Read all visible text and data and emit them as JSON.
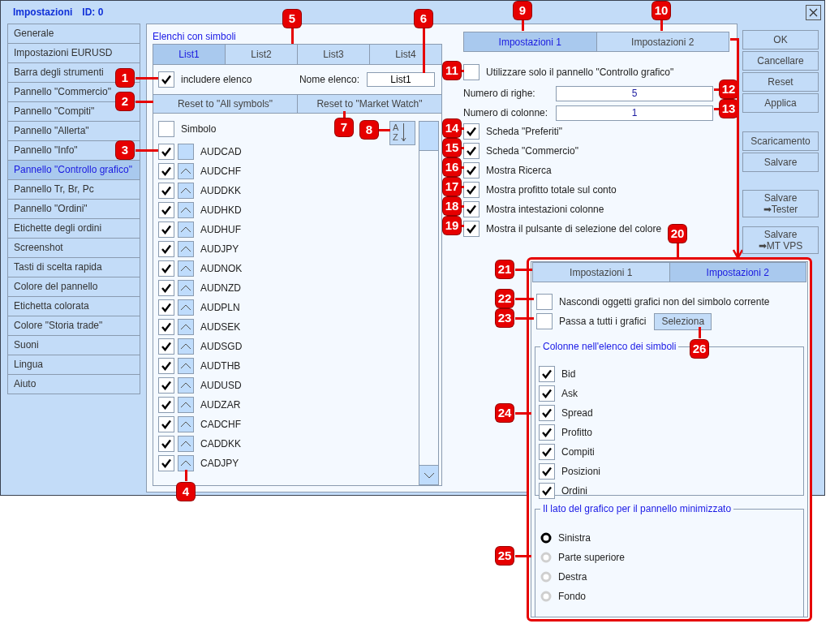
{
  "window": {
    "title": "Impostazioni",
    "id": "ID: 0"
  },
  "sidebar": {
    "items": [
      {
        "label": "Generale",
        "selected": false
      },
      {
        "label": "Impostazioni EURUSD",
        "selected": false
      },
      {
        "label": "Barra degli strumenti",
        "selected": false
      },
      {
        "label": "Pannello \"Commercio\"",
        "selected": false
      },
      {
        "label": "Pannello \"Compiti\"",
        "selected": false
      },
      {
        "label": "Pannello \"Allerta\"",
        "selected": false
      },
      {
        "label": "Pannello \"Info\"",
        "selected": false
      },
      {
        "label": "Pannello \"Controllo grafico\"",
        "selected": true
      },
      {
        "label": "Pannello Tr, Br, Pc",
        "selected": false
      },
      {
        "label": "Pannello \"Ordini\"",
        "selected": false
      },
      {
        "label": "Etichette degli ordini",
        "selected": false
      },
      {
        "label": "Screenshot",
        "selected": false
      },
      {
        "label": "Tasti di scelta rapida",
        "selected": false
      },
      {
        "label": "Colore del pannello",
        "selected": false
      },
      {
        "label": "Etichetta colorata",
        "selected": false
      },
      {
        "label": "Colore \"Storia trade\"",
        "selected": false
      },
      {
        "label": "Suoni",
        "selected": false
      },
      {
        "label": "Lingua",
        "selected": false
      },
      {
        "label": "Aiuto",
        "selected": false
      }
    ]
  },
  "symbol_lists": {
    "title": "Elenchi con simboli",
    "tabs": [
      {
        "label": "List1",
        "selected": true
      },
      {
        "label": "List2",
        "selected": false
      },
      {
        "label": "List3",
        "selected": false
      },
      {
        "label": "List4",
        "selected": false
      }
    ],
    "include": {
      "label": "includere elenco",
      "checked": true
    },
    "name_label": "Nome elenco:",
    "name_value": "List1",
    "reset_buttons": [
      "Reset to \"All symbols\"",
      "Reset to \"Market Watch\""
    ],
    "header": {
      "label": "Simbolo",
      "checked": false
    },
    "sort_button": {
      "top": "A",
      "bottom": "Z"
    },
    "symbols": [
      {
        "name": "AUDCAD",
        "checked": true,
        "arrow": false
      },
      {
        "name": "AUDCHF",
        "checked": true,
        "arrow": true
      },
      {
        "name": "AUDDKK",
        "checked": true,
        "arrow": true
      },
      {
        "name": "AUDHKD",
        "checked": true,
        "arrow": true
      },
      {
        "name": "AUDHUF",
        "checked": true,
        "arrow": true
      },
      {
        "name": "AUDJPY",
        "checked": true,
        "arrow": true
      },
      {
        "name": "AUDNOK",
        "checked": true,
        "arrow": true
      },
      {
        "name": "AUDNZD",
        "checked": true,
        "arrow": true
      },
      {
        "name": "AUDPLN",
        "checked": true,
        "arrow": true
      },
      {
        "name": "AUDSEK",
        "checked": true,
        "arrow": true
      },
      {
        "name": "AUDSGD",
        "checked": true,
        "arrow": true
      },
      {
        "name": "AUDTHB",
        "checked": true,
        "arrow": true
      },
      {
        "name": "AUDUSD",
        "checked": true,
        "arrow": true
      },
      {
        "name": "AUDZAR",
        "checked": true,
        "arrow": true
      },
      {
        "name": "CADCHF",
        "checked": true,
        "arrow": true
      },
      {
        "name": "CADDKK",
        "checked": true,
        "arrow": true
      },
      {
        "name": "CADJPY",
        "checked": true,
        "arrow": true
      }
    ]
  },
  "settings": {
    "tabs": [
      {
        "label": "Impostazioni 1",
        "selected": true
      },
      {
        "label": "Impostazioni 2",
        "selected": false
      }
    ],
    "use_only": {
      "label": "Utilizzare solo il pannello \"Controllo grafico\"",
      "checked": false
    },
    "fields": [
      {
        "label": "Numero di righe:",
        "value": "5"
      },
      {
        "label": "Numero di colonne:",
        "value": "1"
      }
    ],
    "options": [
      {
        "label": "Scheda \"Preferiti\"",
        "checked": true
      },
      {
        "label": "Scheda \"Commercio\"",
        "checked": true
      },
      {
        "label": "Mostra Ricerca",
        "checked": true
      },
      {
        "label": "Mostra profitto totale sul conto",
        "checked": true
      },
      {
        "label": "Mostra intestazioni colonne",
        "checked": true
      },
      {
        "label": "Mostra il pulsante di selezione del colore",
        "checked": true
      }
    ]
  },
  "button_groups": [
    [
      {
        "lines": [
          "OK"
        ]
      },
      {
        "lines": [
          "Cancellare"
        ]
      },
      {
        "lines": [
          "Reset"
        ]
      },
      {
        "lines": [
          "Applica"
        ]
      }
    ],
    [
      {
        "lines": [
          "Scaricamento"
        ]
      },
      {
        "lines": [
          "Salvare"
        ]
      }
    ],
    [
      {
        "lines": [
          "Salvare",
          "➡Tester"
        ]
      },
      {
        "lines": [
          "Salvare",
          "➡MT VPS"
        ]
      }
    ]
  ],
  "popup": {
    "tabs": [
      {
        "label": "Impostazioni 1",
        "selected": false
      },
      {
        "label": "Impostazioni 2",
        "selected": true
      }
    ],
    "options": [
      {
        "label": "Nascondi oggetti grafici non del simbolo corrente",
        "checked": false
      },
      {
        "label": "Passa a tutti i grafici",
        "checked": false
      }
    ],
    "select_button": "Seleziona",
    "columns": {
      "title": "Colonne nell'elenco dei simboli",
      "items": [
        {
          "label": "Bid",
          "checked": true
        },
        {
          "label": "Ask",
          "checked": true
        },
        {
          "label": "Spread",
          "checked": true
        },
        {
          "label": "Profitto",
          "checked": true
        },
        {
          "label": "Compiti",
          "checked": true
        },
        {
          "label": "Posizioni",
          "checked": true
        },
        {
          "label": "Ordini",
          "checked": true
        }
      ]
    },
    "side": {
      "title": "Il lato del grafico per il pannello minimizzato",
      "options": [
        {
          "label": "Sinistra",
          "selected": true
        },
        {
          "label": "Parte superiore",
          "selected": false
        },
        {
          "label": "Destra",
          "selected": false
        },
        {
          "label": "Fondo",
          "selected": false
        }
      ]
    }
  },
  "callouts": [
    "1",
    "2",
    "3",
    "4",
    "5",
    "6",
    "7",
    "8",
    "9",
    "10",
    "11",
    "12",
    "13",
    "14",
    "15",
    "16",
    "17",
    "18",
    "19",
    "20",
    "21",
    "22",
    "23",
    "24",
    "25",
    "26"
  ]
}
